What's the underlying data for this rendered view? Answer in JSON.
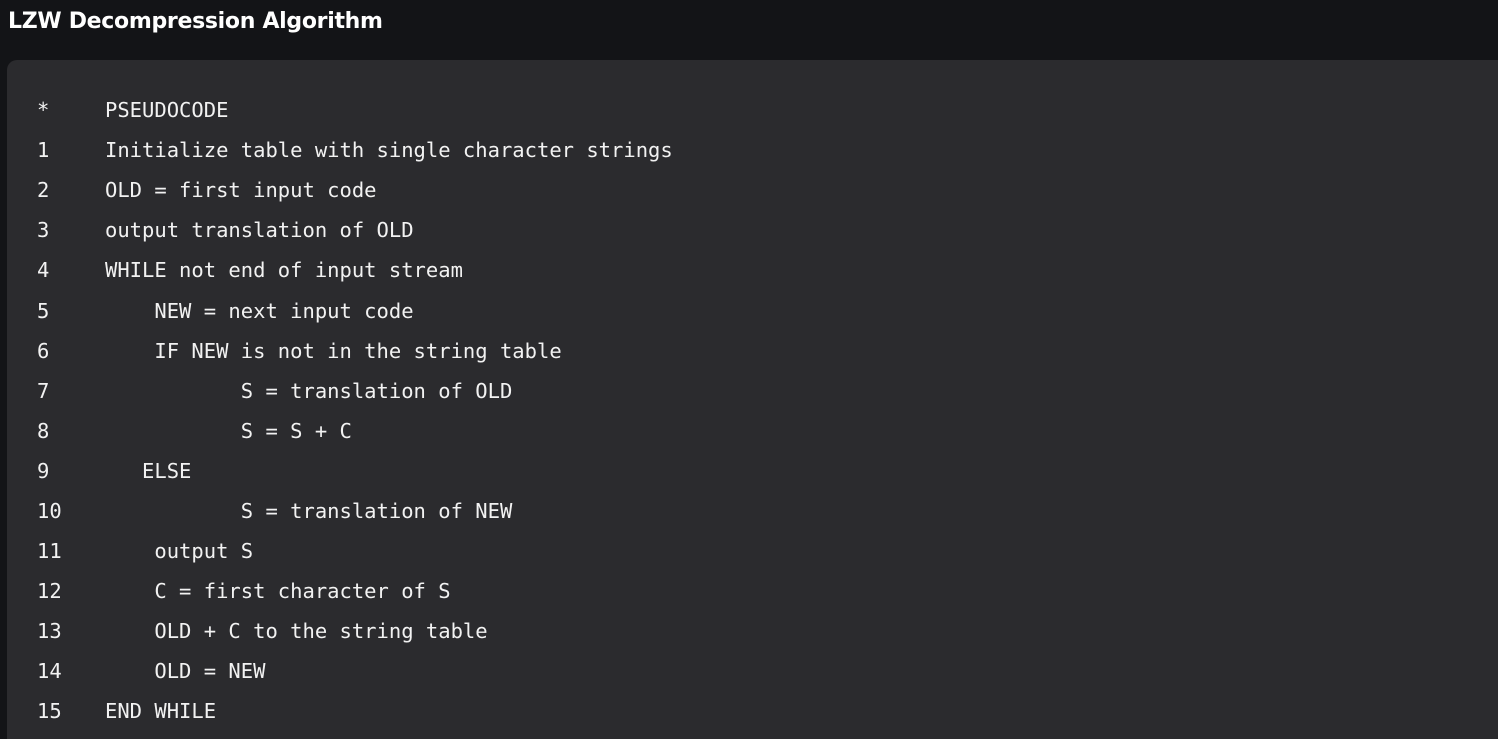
{
  "title": "LZW Decompression Algorithm",
  "code": {
    "lines": [
      {
        "number": "*",
        "text": "PSEUDOCODE"
      },
      {
        "number": "1",
        "text": "Initialize table with single character strings"
      },
      {
        "number": "2",
        "text": "OLD = first input code"
      },
      {
        "number": "3",
        "text": "output translation of OLD"
      },
      {
        "number": "4",
        "text": "WHILE not end of input stream"
      },
      {
        "number": "5",
        "text": "    NEW = next input code"
      },
      {
        "number": "6",
        "text": "    IF NEW is not in the string table"
      },
      {
        "number": "7",
        "text": "           S = translation of OLD"
      },
      {
        "number": "8",
        "text": "           S = S + C"
      },
      {
        "number": "9",
        "text": "   ELSE"
      },
      {
        "number": "10",
        "text": "           S = translation of NEW"
      },
      {
        "number": "11",
        "text": "    output S"
      },
      {
        "number": "12",
        "text": "    C = first character of S"
      },
      {
        "number": "13",
        "text": "    OLD + C to the string table"
      },
      {
        "number": "14",
        "text": "    OLD = NEW"
      },
      {
        "number": "15",
        "text": "END WHILE"
      }
    ]
  }
}
